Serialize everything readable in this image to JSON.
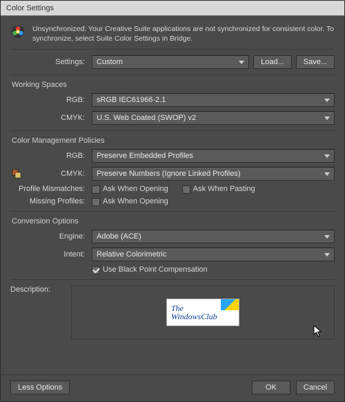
{
  "window": {
    "title": "Color Settings"
  },
  "sync": {
    "text": "Unsynchronized: Your Creative Suite applications are not synchronized for consistent color. To synchronize, select Suite Color Settings in Bridge."
  },
  "settings": {
    "label": "Settings:",
    "value": "Custom",
    "load_label": "Load...",
    "save_label": "Save..."
  },
  "working_spaces": {
    "title": "Working Spaces",
    "rgb_label": "RGB:",
    "rgb_value": "sRGB IEC61966-2.1",
    "cmyk_label": "CMYK:",
    "cmyk_value": "U.S. Web Coated (SWOP) v2"
  },
  "policies": {
    "title": "Color Management Policies",
    "rgb_label": "RGB:",
    "rgb_value": "Preserve Embedded Profiles",
    "cmyk_label": "CMYK:",
    "cmyk_value": "Preserve Numbers (Ignore Linked Profiles)",
    "mismatch_label": "Profile Mismatches:",
    "ask_open": "Ask When Opening",
    "ask_paste": "Ask When Pasting",
    "missing_label": "Missing Profiles:"
  },
  "conversion": {
    "title": "Conversion Options",
    "engine_label": "Engine:",
    "engine_value": "Adobe (ACE)",
    "intent_label": "Intent:",
    "intent_value": "Relative Colorimetric",
    "bpc_label": "Use Black Point Compensation"
  },
  "description": {
    "label": "Description:",
    "box_line1": "The",
    "box_line2": "WindowsClub"
  },
  "footer": {
    "less_label": "Less Options",
    "ok_label": "OK",
    "cancel_label": "Cancel"
  }
}
